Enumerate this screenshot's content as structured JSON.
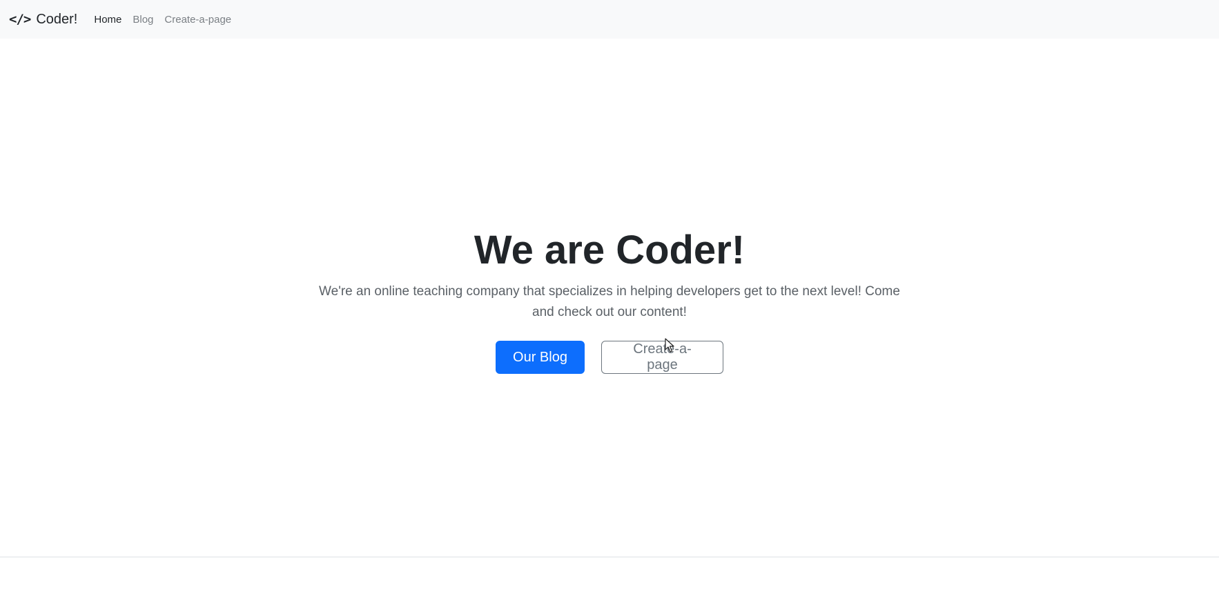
{
  "navbar": {
    "brand_icon": "</>",
    "brand_text": "Coder!",
    "links": [
      {
        "label": "Home",
        "active": true
      },
      {
        "label": "Blog",
        "active": false
      },
      {
        "label": "Create-a-page",
        "active": false
      }
    ]
  },
  "hero": {
    "title": "We are Coder!",
    "lead": "We're an online teaching company that specializes in helping developers get to the next level! Come and check out our content!",
    "primary_button": "Our Blog",
    "secondary_button": "Create-a-page"
  },
  "colors": {
    "primary": "#0d6efd",
    "secondary": "#6c757d",
    "navbar_bg": "#f8f9fa",
    "text": "#212529"
  },
  "icons": {
    "brand": "code-icon",
    "cursor": "mouse-pointer-icon"
  }
}
